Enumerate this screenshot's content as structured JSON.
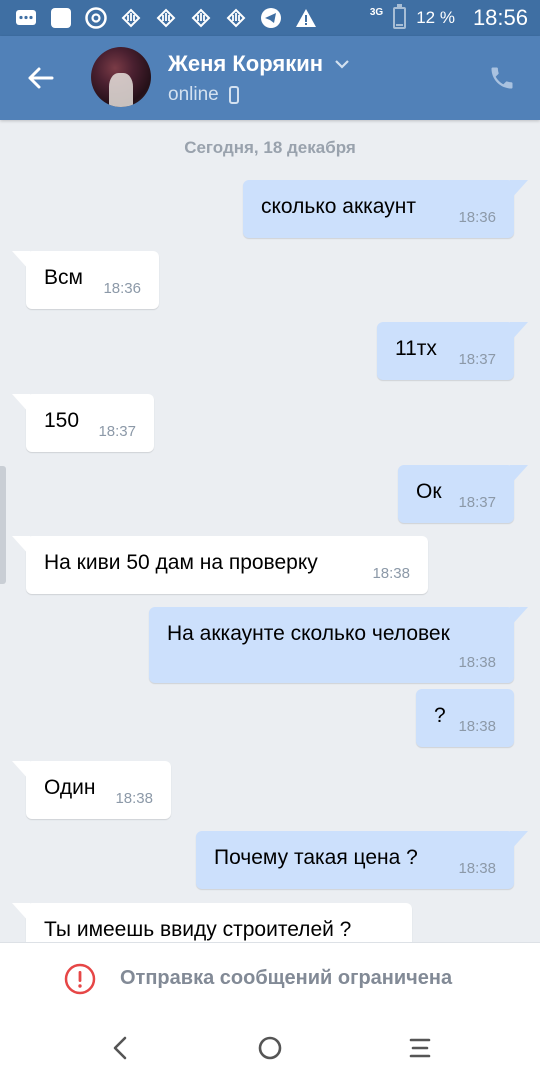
{
  "status_bar": {
    "icons": [
      "messages-icon",
      "app-icon",
      "chrome-icon",
      "hand-icon",
      "hand-icon",
      "hand-icon",
      "hand-icon",
      "telegram-icon",
      "warning-icon"
    ],
    "network": "3G",
    "battery": "12 %",
    "battery_level": 0.12,
    "time": "18:56"
  },
  "header": {
    "contact_name": "Женя Корякин",
    "presence": "online",
    "back_icon": "arrow-back-icon",
    "call_icon": "phone-icon",
    "device_icon": "mobile-icon"
  },
  "chat": {
    "date_separator": "Сегодня, 18 декабря",
    "messages": [
      {
        "direction": "out",
        "text": "сколько аккаунт",
        "time": "18:36"
      },
      {
        "direction": "in",
        "text": "Всм",
        "time": "18:36"
      },
      {
        "direction": "out",
        "text": "11тх",
        "time": "18:37"
      },
      {
        "direction": "in",
        "text": "150",
        "time": "18:37"
      },
      {
        "direction": "out",
        "text": "Ок",
        "time": "18:37"
      },
      {
        "direction": "in",
        "text": "На киви 50 дам на проверку",
        "time": "18:38"
      },
      {
        "direction": "out",
        "text": "На аккаунте сколько человек",
        "time": "18:38"
      },
      {
        "direction": "out",
        "text": "?",
        "time": "18:38"
      },
      {
        "direction": "in",
        "text": "Один",
        "time": "18:38"
      },
      {
        "direction": "out",
        "text": "Почему такая цена ?",
        "time": "18:38"
      },
      {
        "direction": "in",
        "text": "Ты имеешь ввиду строителей ?",
        "time": ""
      }
    ]
  },
  "restricted_bar": {
    "icon": "alert-circle-icon",
    "text": "Отправка сообщений ограничена"
  },
  "nav": {
    "back": "nav-back-icon",
    "home": "nav-home-icon",
    "menu": "nav-menu-icon"
  },
  "colors": {
    "header": "#5181b8",
    "status_bar": "#3f6fa3",
    "outgoing_bubble": "#cce0fc",
    "incoming_bubble": "#ffffff",
    "background": "#ebeef2",
    "alert": "#e64646"
  }
}
